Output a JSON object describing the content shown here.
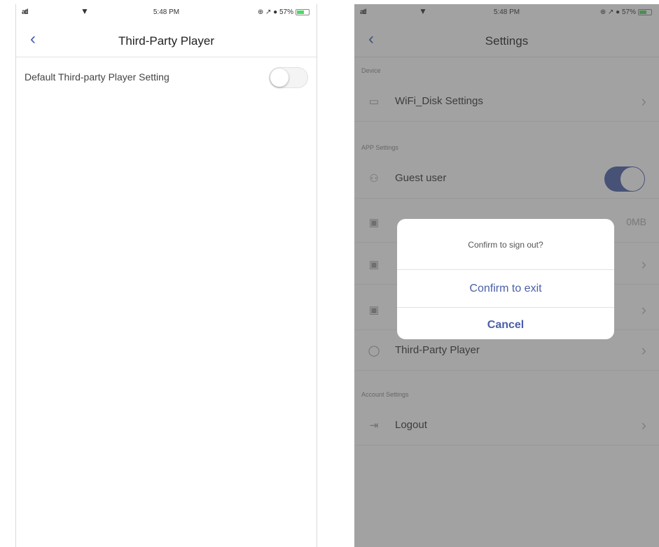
{
  "left_screen": {
    "status": {
      "signal": "atl",
      "time": "5:48 PM",
      "indicators": "⊕ ↗ ● 57%"
    },
    "nav": {
      "back_icon": "chevron-left-icon",
      "title": "Third-Party Player"
    },
    "setting": {
      "label": "Default Third-party Player Setting",
      "enabled": false
    }
  },
  "right_screen": {
    "status": {
      "signal": "atl",
      "time": "5:48 PM",
      "indicators": "⊕ ↗ ● 57%"
    },
    "nav": {
      "back_icon": "chevron-left-icon",
      "title": "Settings"
    },
    "sections": {
      "device": "Device",
      "app": "APP Settings",
      "account": "Account Settings"
    },
    "rows": {
      "wifi_disk": "WiFi_Disk Settings",
      "guest_user": "Guest user",
      "cache_value": "0MB",
      "third_party": "Third-Party Player",
      "logout": "Logout"
    },
    "guest_user_enabled": true,
    "dialog": {
      "message": "Confirm to sign out?",
      "confirm": "Confirm to exit",
      "cancel": "Cancel"
    }
  },
  "colors": {
    "accent": "#4a5ea8",
    "battery": "#4cd964",
    "overlay": "rgba(70,70,70,0.5)"
  }
}
